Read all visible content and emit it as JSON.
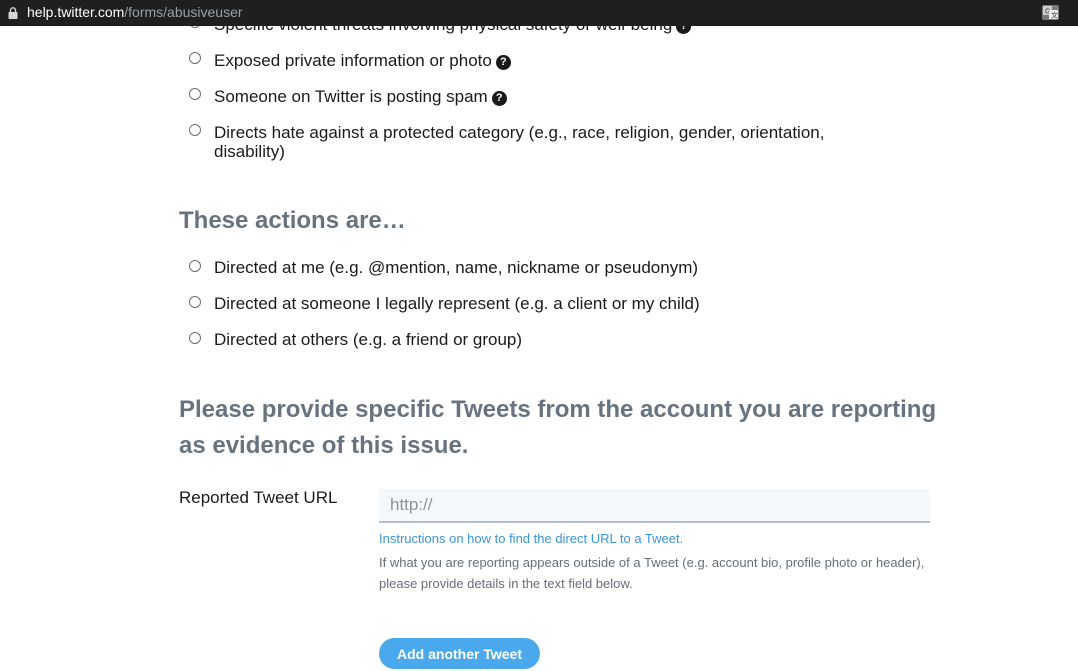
{
  "browser": {
    "url_host": "help.twitter.com",
    "url_path": "/forms/abusiveuser"
  },
  "report_options": [
    {
      "label": "Specific violent threats involving physical safety or well-being",
      "has_help_icon": true
    },
    {
      "label": "Exposed private information or photo",
      "has_help_icon": true
    },
    {
      "label": "Someone on Twitter is posting spam",
      "has_help_icon": true
    },
    {
      "label": "Directs hate against a protected category (e.g., race, religion, gender, orientation, disability)",
      "has_help_icon": false
    }
  ],
  "help_icon_glyph": "?",
  "actions_section": {
    "heading": "These actions are…",
    "options": [
      {
        "label": "Directed at me (e.g. @mention, name, nickname or pseudonym)"
      },
      {
        "label": "Directed at someone I legally represent (e.g. a client or my child)"
      },
      {
        "label": "Directed at others (e.g. a friend or group)"
      }
    ]
  },
  "evidence_section": {
    "heading": "Please provide specific Tweets from the account you are reporting as evidence of this issue.",
    "field_label": "Reported Tweet URL",
    "input_placeholder": "http://",
    "input_value": "",
    "help_link": "Instructions on how to find the direct URL to a Tweet.",
    "help_text": "If what you are reporting appears outside of a Tweet (e.g. account bio, profile photo or header), please provide details in the text field below.",
    "add_button": "Add another Tweet"
  },
  "colors": {
    "heading": "#67737e",
    "link": "#3b94d9",
    "button": "#4aa8ec",
    "input_bg": "#f5f8fa"
  }
}
